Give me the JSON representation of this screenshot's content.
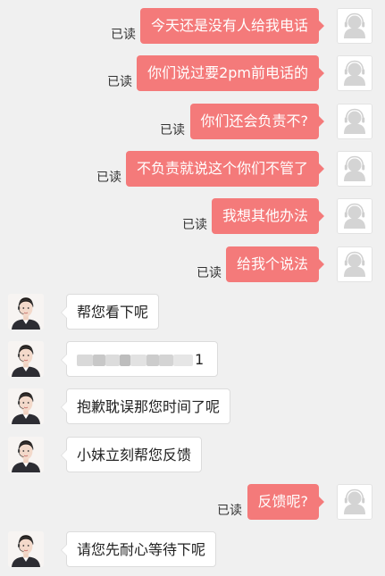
{
  "messages": [
    {
      "side": "sent",
      "text": "今天还是没有人给我电话",
      "status": "已读"
    },
    {
      "side": "sent",
      "text": "你们说过要2pm前电话的",
      "status": "已读"
    },
    {
      "side": "sent",
      "text": "你们还会负责不?",
      "status": "已读"
    },
    {
      "side": "sent",
      "text": "不负责就说这个你们不管了",
      "status": "已读"
    },
    {
      "side": "sent",
      "text": "我想其他办法",
      "status": "已读"
    },
    {
      "side": "sent",
      "text": "给我个说法",
      "status": "已读"
    },
    {
      "side": "recv",
      "text": "帮您看下呢"
    },
    {
      "side": "recv",
      "text": "1",
      "redacted": true
    },
    {
      "side": "recv",
      "text": "抱歉耽误那您时间了呢"
    },
    {
      "side": "recv",
      "text": "小妹立刻帮您反馈"
    },
    {
      "side": "sent",
      "text": "反馈呢?",
      "status": "已读"
    },
    {
      "side": "recv",
      "text": "请您先耐心等待下呢"
    }
  ],
  "avatars": {
    "user": "default-user-avatar-icon",
    "agent": "customer-service-agent-avatar"
  },
  "colors": {
    "page_background": "#f0f0f0",
    "sent_bubble": "#f47a7a",
    "sent_text": "#ffffff",
    "recv_bubble": "#ffffff",
    "recv_text": "#222222",
    "read_status": "#333333"
  }
}
